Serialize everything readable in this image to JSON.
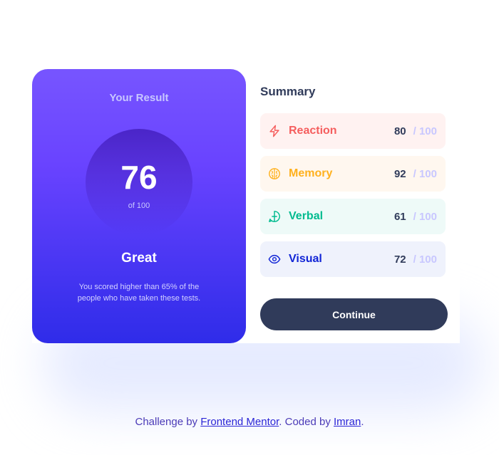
{
  "result": {
    "title": "Your Result",
    "score": "76",
    "of_label": "of 100",
    "grade": "Great",
    "description": "You scored higher than 65% of the people who have taken these tests."
  },
  "summary": {
    "title": "Summary",
    "items": [
      {
        "label": "Reaction",
        "score": "80",
        "max": "/ 100",
        "icon": "lightning-icon",
        "color": "#f55e5e",
        "bg": "#fff2f1"
      },
      {
        "label": "Memory",
        "score": "92",
        "max": "/ 100",
        "icon": "brain-icon",
        "color": "#ffb11e",
        "bg": "#fff7ef"
      },
      {
        "label": "Verbal",
        "score": "61",
        "max": "/ 100",
        "icon": "chat-bubble-icon",
        "color": "#00bb8f",
        "bg": "#eefaf8"
      },
      {
        "label": "Visual",
        "score": "72",
        "max": "/ 100",
        "icon": "eye-icon",
        "color": "#1125d6",
        "bg": "#eff2fc"
      }
    ],
    "continue_label": "Continue"
  },
  "footer": {
    "prefix": "Challenge by ",
    "link1": "Frontend Mentor",
    "middle": ". Coded by ",
    "link2": "Imran",
    "suffix": "."
  }
}
